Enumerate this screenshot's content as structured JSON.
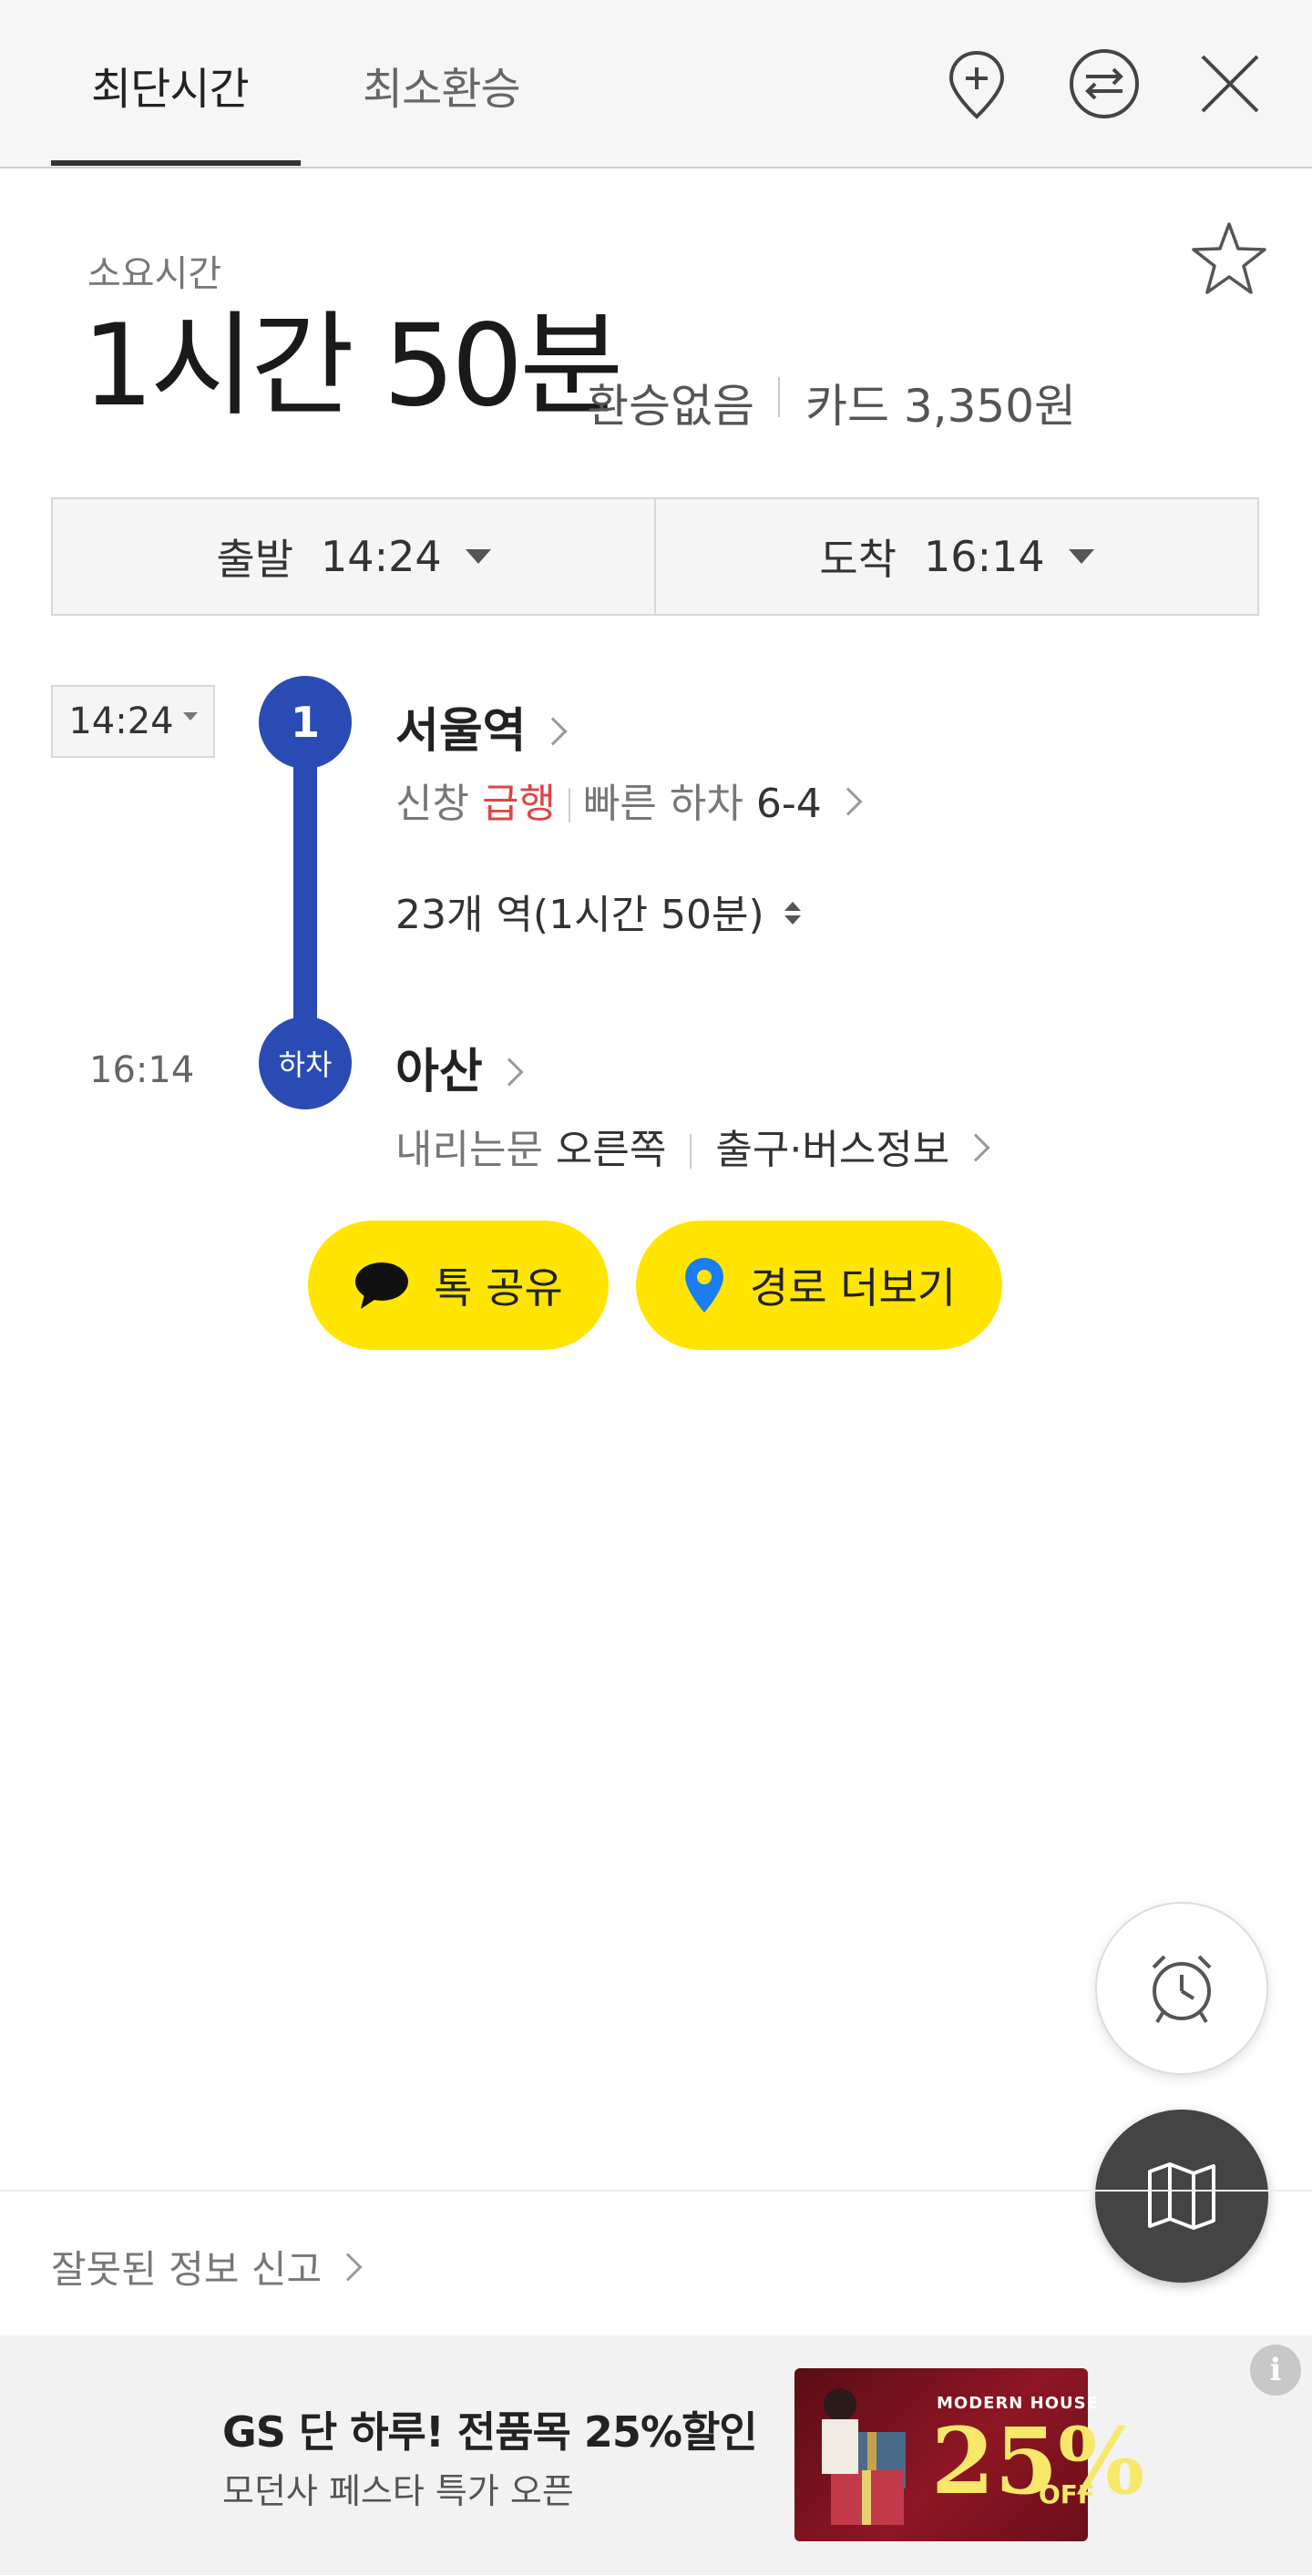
{
  "tabs": {
    "active": "최단시간",
    "inactive": "최소환승"
  },
  "icons": {
    "add_pin": "pin-plus-icon",
    "swap": "swap-route-icon",
    "close": "close-icon",
    "favorite": "star-icon",
    "alarm": "alarm-clock-icon",
    "map": "map-icon",
    "info": "info-icon",
    "share": "speech-bubble-icon",
    "route": "location-pin-icon"
  },
  "summary": {
    "label": "소요시간",
    "duration": "1시간 50분",
    "transfer": "환승없음",
    "fare": "카드 3,350원"
  },
  "selector": {
    "departure_label": "출발",
    "departure_time": "14:24",
    "arrival_label": "도착",
    "arrival_time": "16:14"
  },
  "route": {
    "board_time": "14:24",
    "line_number": "1",
    "line_color": "#2b4bb4",
    "from_station": "서울역",
    "direction": "신창",
    "train_type": "급행",
    "fast_exit_label": "빠른 하차",
    "fast_exit_value": "6-4",
    "stops_summary": "23개 역(1시간 50분)",
    "alight_badge": "하차",
    "arrive_time": "16:14",
    "to_station": "아산",
    "door_label": "내리는문",
    "door_side": "오른쪽",
    "exit_info": "출구·버스정보"
  },
  "actions": {
    "share_label": "톡 공유",
    "more_route_label": "경로 더보기"
  },
  "report": {
    "label": "잘못된 정보 신고"
  },
  "ad": {
    "title": "GS 단 하루! 전품목 25%할인",
    "subtitle": "모던사 페스타 특가 오픈",
    "brand": "MODERN HOUSE",
    "percent": "25%",
    "off": "OFF",
    "info": "i"
  },
  "colors": {
    "accent_yellow": "#ffe500",
    "express_red": "#e04444",
    "line_blue": "#2b4bb4"
  }
}
